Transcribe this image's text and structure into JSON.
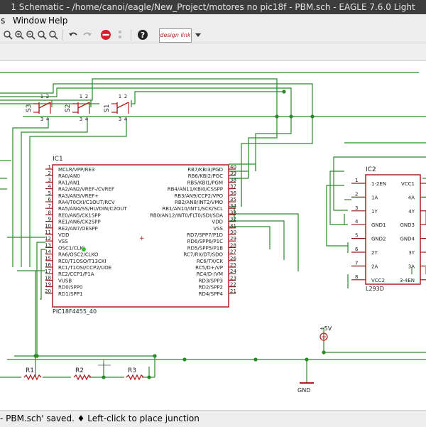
{
  "window": {
    "title": "1 Schematic - /home/canoi/eagle/New_Project/motores no pic18f - PBM.sch - EAGLE 7.6.0 Light"
  },
  "menu": {
    "items": [
      "s",
      "Window",
      "Help"
    ]
  },
  "toolbar": {
    "design_link": "design link"
  },
  "status": {
    "text": "- PBM.sch' saved.  ♦ Left-click to place junction"
  },
  "colors": {
    "wire": "#2a8a2a",
    "part": "#b02020",
    "pin": "#8a1a1a",
    "text": "#222222"
  },
  "schematic": {
    "switches": [
      {
        "name": "S3",
        "pins": [
          "1",
          "2",
          "3",
          "4"
        ]
      },
      {
        "name": "S2",
        "pins": [
          "1",
          "2",
          "3",
          "4"
        ]
      },
      {
        "name": "S1",
        "pins": [
          "1",
          "2",
          "3",
          "4"
        ]
      }
    ],
    "ic1": {
      "name": "IC1",
      "value": "PIC18F4455_40",
      "left_pins": [
        {
          "num": "1",
          "label": "MCLR/VPP/RE3"
        },
        {
          "num": "2",
          "label": "RA0/AN0"
        },
        {
          "num": "3",
          "label": "RA1/AN1"
        },
        {
          "num": "4",
          "label": "RA2/AN2/VREF-/CVREF"
        },
        {
          "num": "5",
          "label": "RA3/AN3/VREF+"
        },
        {
          "num": "6",
          "label": "RA4/T0CKI/C1OUT/RCV"
        },
        {
          "num": "7",
          "label": "RA5/AN4/SS/HLVDIN/C2OUT"
        },
        {
          "num": "8",
          "label": "RE0/AN5/CK1SPP"
        },
        {
          "num": "9",
          "label": "RE1/AN6/CK2SPP"
        },
        {
          "num": "10",
          "label": "RE2/AN7/OESPP"
        },
        {
          "num": "11",
          "label": "VDD"
        },
        {
          "num": "12",
          "label": "VSS"
        },
        {
          "num": "13",
          "label": "OSC1/CLKI"
        },
        {
          "num": "14",
          "label": "RA6/OSC2/CLKO"
        },
        {
          "num": "15",
          "label": "RC0/T1OSO/T13CKI"
        },
        {
          "num": "16",
          "label": "RC1/T1OSI/CCP2/UOE"
        },
        {
          "num": "17",
          "label": "RC2/CCP1/P1A"
        },
        {
          "num": "18",
          "label": "VUSB"
        },
        {
          "num": "19",
          "label": "RD0/SPP0"
        },
        {
          "num": "20",
          "label": "RD1/SPP1"
        }
      ],
      "right_pins": [
        {
          "num": "40",
          "label": "RB7/KBI3/PGD"
        },
        {
          "num": "39",
          "label": "RB6/KBI2/PGC"
        },
        {
          "num": "38",
          "label": "RB5/KBI1/PGM"
        },
        {
          "num": "37",
          "label": "RB4/AN11/KBI0/CSSPP"
        },
        {
          "num": "36",
          "label": "RB3/AN9/CCP2/VPO"
        },
        {
          "num": "35",
          "label": "RB2/AN8/INT2/VMO"
        },
        {
          "num": "34",
          "label": "RB1/AN10/INT1/SCK/SCL"
        },
        {
          "num": "33",
          "label": "RB0/AN12/INT0/FLT0/SDI/SDA"
        },
        {
          "num": "32",
          "label": "VDD"
        },
        {
          "num": "31",
          "label": "VSS"
        },
        {
          "num": "30",
          "label": "RD7/SPP7/P1D"
        },
        {
          "num": "29",
          "label": "RD6/SPP6/P1C"
        },
        {
          "num": "28",
          "label": "RD5/SPP5/P1B"
        },
        {
          "num": "27",
          "label": "RC7/RX/DT/SDO"
        },
        {
          "num": "26",
          "label": "RC6/TX/CK"
        },
        {
          "num": "25",
          "label": "RC5/D+/VP"
        },
        {
          "num": "24",
          "label": "RC4/D-/VM"
        },
        {
          "num": "23",
          "label": "RD3/SPP3"
        },
        {
          "num": "22",
          "label": "RD2/SPP2"
        },
        {
          "num": "21",
          "label": "RD4/SPP4"
        }
      ]
    },
    "ic2": {
      "name": "IC2",
      "value": "L293D",
      "left_pins": [
        {
          "num": "1",
          "label": "1-2EN"
        },
        {
          "num": "2",
          "label": "1A"
        },
        {
          "num": "3",
          "label": "1Y"
        },
        {
          "num": "4",
          "label": "GND1"
        },
        {
          "num": "5",
          "label": "GND2"
        },
        {
          "num": "6",
          "label": "2Y"
        },
        {
          "num": "7",
          "label": "2A"
        },
        {
          "num": "8",
          "label": "VCC2"
        }
      ],
      "right_pins": [
        {
          "label": "VCC1"
        },
        {
          "label": "4A"
        },
        {
          "label": "4Y"
        },
        {
          "label": "GND3"
        },
        {
          "label": "GND4"
        },
        {
          "label": "3Y"
        },
        {
          "label": "3A"
        },
        {
          "label": "3-4EN"
        }
      ]
    },
    "resistors": [
      "R1",
      "R2",
      "R3"
    ],
    "supply": "+5V",
    "ground": "GND"
  }
}
